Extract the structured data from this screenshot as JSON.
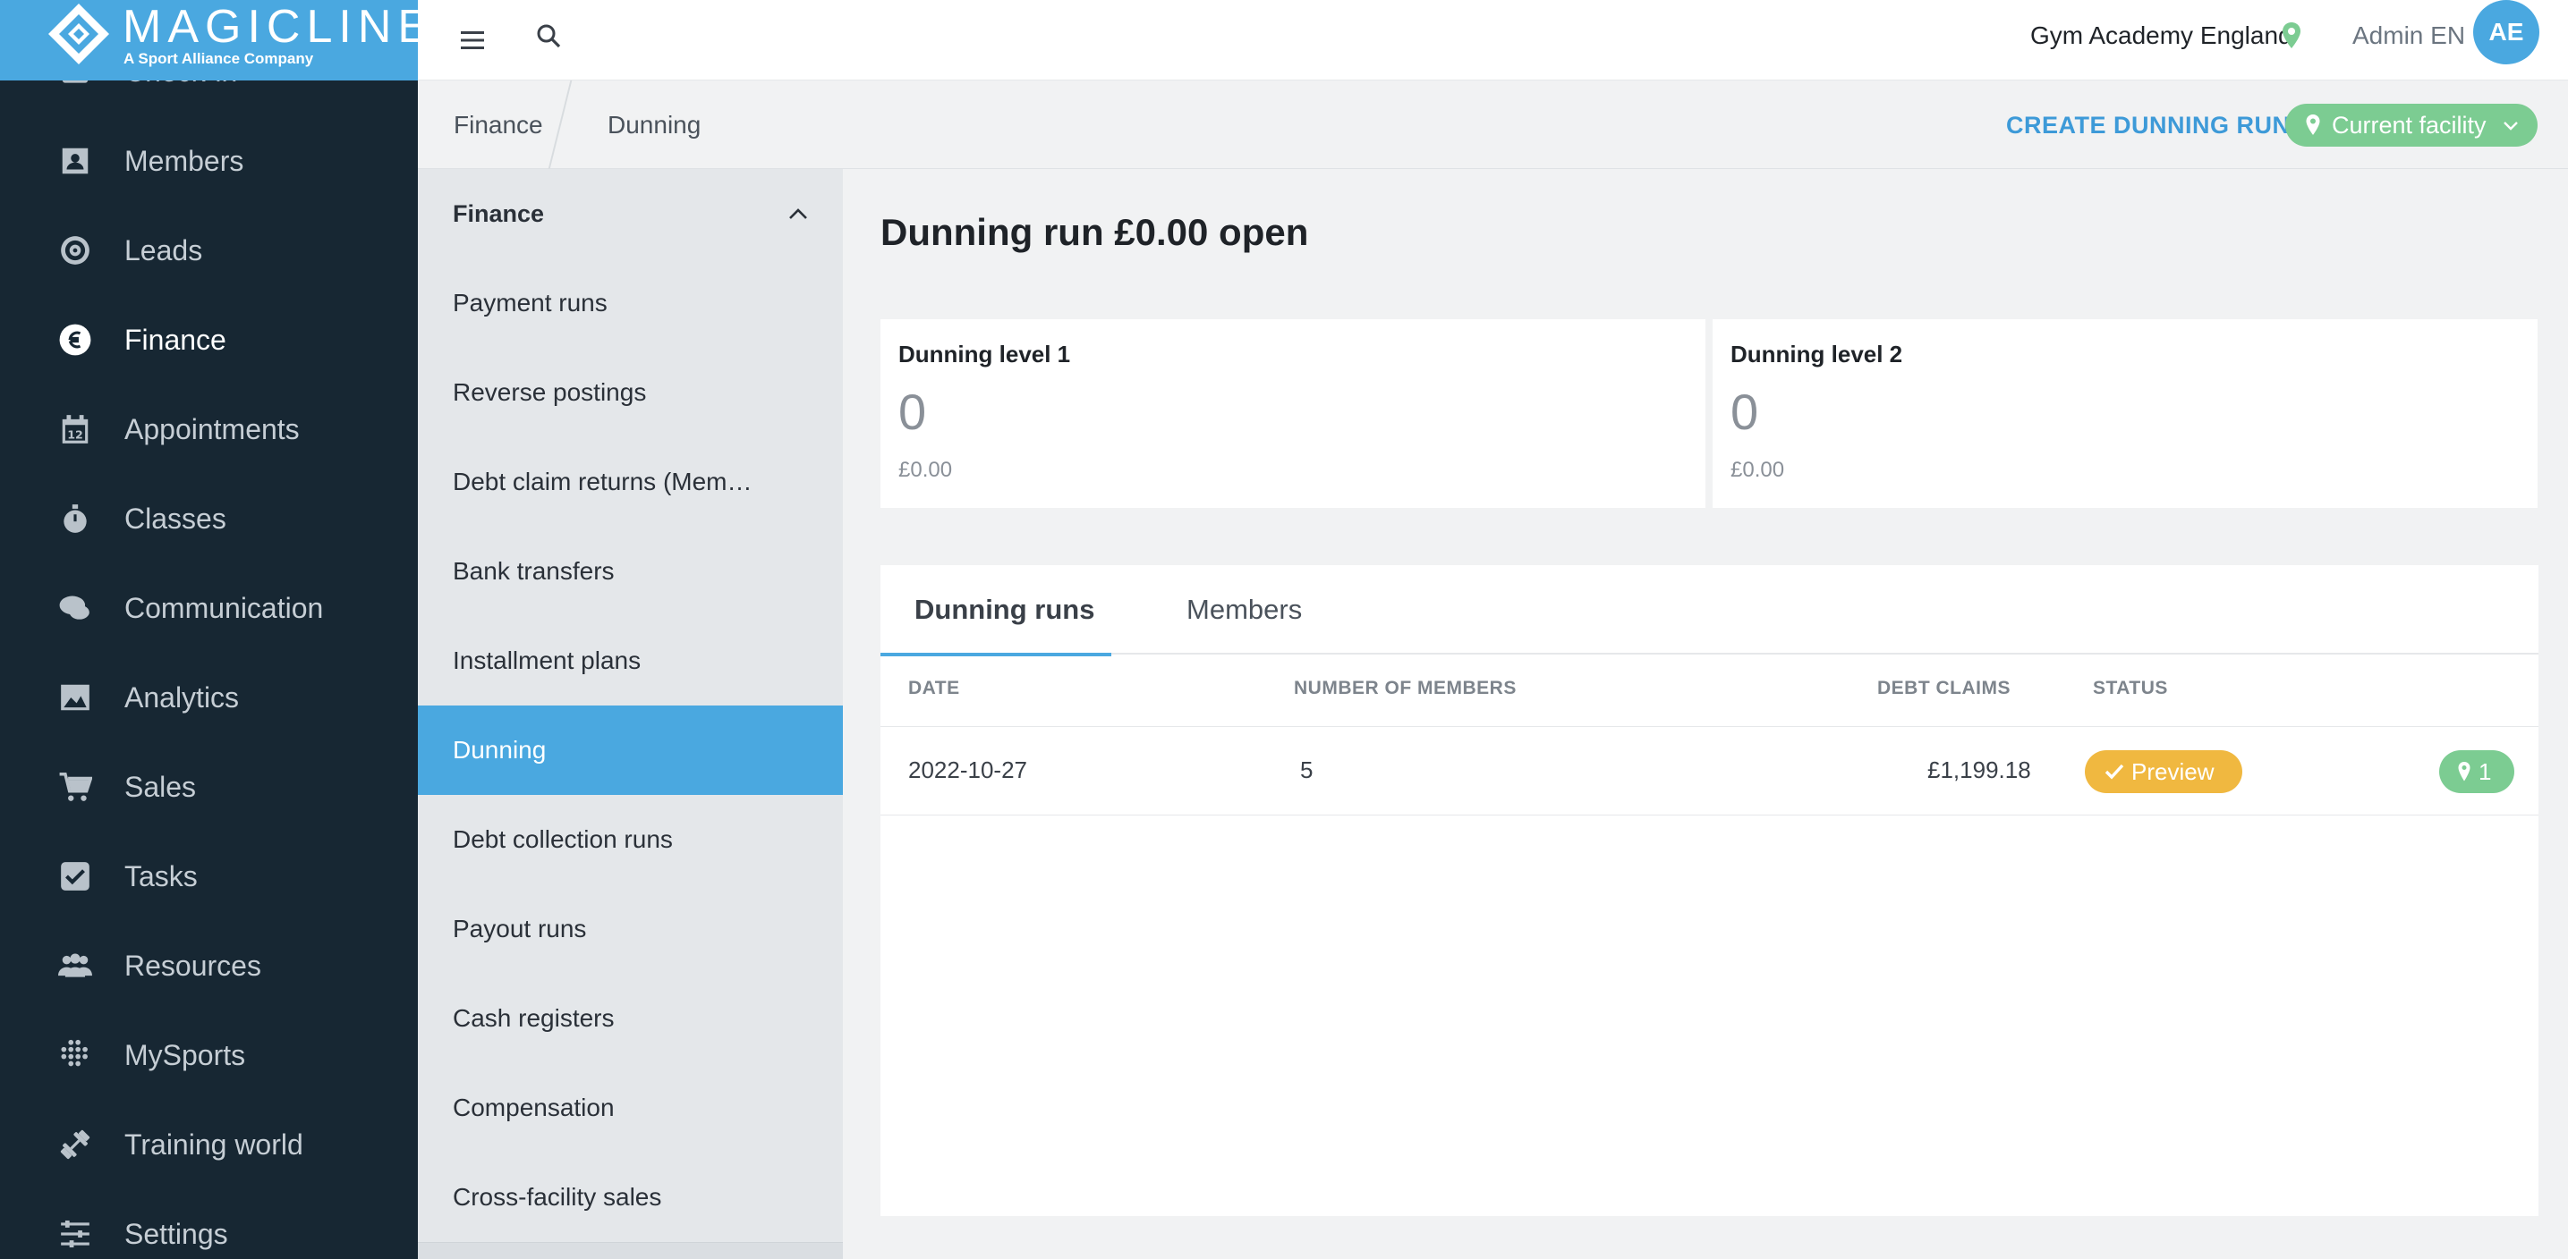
{
  "brand": {
    "name": "MAGICLINE",
    "tagline": "A Sport Alliance Company",
    "color": "#4aa8e0"
  },
  "nav": {
    "items": [
      {
        "label": "Check-in",
        "icon": "check-in-icon"
      },
      {
        "label": "Members",
        "icon": "members-icon"
      },
      {
        "label": "Leads",
        "icon": "leads-icon"
      },
      {
        "label": "Finance",
        "icon": "euro-icon",
        "active": true
      },
      {
        "label": "Appointments",
        "icon": "calendar-icon"
      },
      {
        "label": "Classes",
        "icon": "stopwatch-icon"
      },
      {
        "label": "Communication",
        "icon": "chat-icon"
      },
      {
        "label": "Analytics",
        "icon": "chart-icon"
      },
      {
        "label": "Sales",
        "icon": "cart-icon"
      },
      {
        "label": "Tasks",
        "icon": "checkbox-icon"
      },
      {
        "label": "Resources",
        "icon": "people-icon"
      },
      {
        "label": "MySports",
        "icon": "dots-grid-icon"
      },
      {
        "label": "Training world",
        "icon": "dumbbell-icon"
      },
      {
        "label": "Settings",
        "icon": "sliders-icon"
      }
    ]
  },
  "topbar": {
    "facility": "Gym Academy England",
    "user": "Admin EN",
    "avatar_initials": "AE"
  },
  "breadcrumb": {
    "items": [
      "Finance",
      "Dunning"
    ],
    "action": "CREATE DUNNING RUN",
    "facility_filter": "Current facility"
  },
  "subnav": {
    "header": "Finance",
    "items": [
      {
        "label": "Payment runs"
      },
      {
        "label": "Reverse postings"
      },
      {
        "label": "Debt claim returns (Mem…"
      },
      {
        "label": "Bank transfers"
      },
      {
        "label": "Installment plans"
      },
      {
        "label": "Dunning",
        "active": true
      },
      {
        "label": "Debt collection runs"
      },
      {
        "label": "Payout runs"
      },
      {
        "label": "Cash registers"
      },
      {
        "label": "Compensation"
      },
      {
        "label": "Cross-facility sales"
      }
    ]
  },
  "main": {
    "title": "Dunning run £0.00 open",
    "levels": [
      {
        "title": "Dunning level 1",
        "count": "0",
        "amount": "£0.00"
      },
      {
        "title": "Dunning level 2",
        "count": "0",
        "amount": "£0.00"
      }
    ],
    "tabs": [
      {
        "label": "Dunning runs",
        "active": true
      },
      {
        "label": "Members"
      }
    ],
    "table": {
      "headers": [
        "DATE",
        "NUMBER OF MEMBERS",
        "DEBT CLAIMS",
        "STATUS"
      ],
      "rows": [
        {
          "date": "2022-10-27",
          "members": "5",
          "debt_claims": "£1,199.18",
          "status": "Preview",
          "facility_count": "1"
        }
      ]
    }
  },
  "colors": {
    "sidebar_bg": "#172733",
    "accent": "#4aa8e0",
    "status_preview": "#f0b840",
    "facility_green": "#7ccc92"
  }
}
